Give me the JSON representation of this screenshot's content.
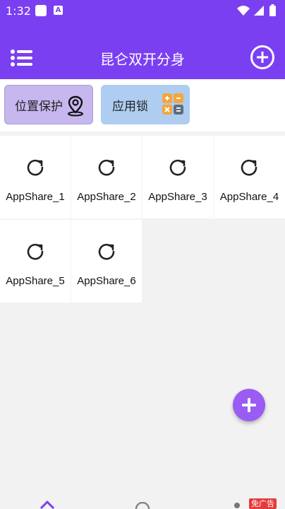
{
  "status_bar": {
    "time": "1:32",
    "a_badge": "A"
  },
  "app_bar": {
    "title": "昆仑双开分身"
  },
  "quick_actions": [
    {
      "label": "位置保护",
      "icon": "location-pin-icon"
    },
    {
      "label": "应用锁",
      "icon": "calculator-icon"
    }
  ],
  "apps": [
    {
      "label": "AppShare_1"
    },
    {
      "label": "AppShare_2"
    },
    {
      "label": "AppShare_3"
    },
    {
      "label": "AppShare_4"
    },
    {
      "label": "AppShare_5"
    },
    {
      "label": "AppShare_6"
    }
  ],
  "bottom_nav": {
    "badge": "免广告"
  },
  "colors": {
    "primary": "#7b3ff2",
    "fab": "#9a5cf2",
    "badge": "#e53b3b"
  }
}
